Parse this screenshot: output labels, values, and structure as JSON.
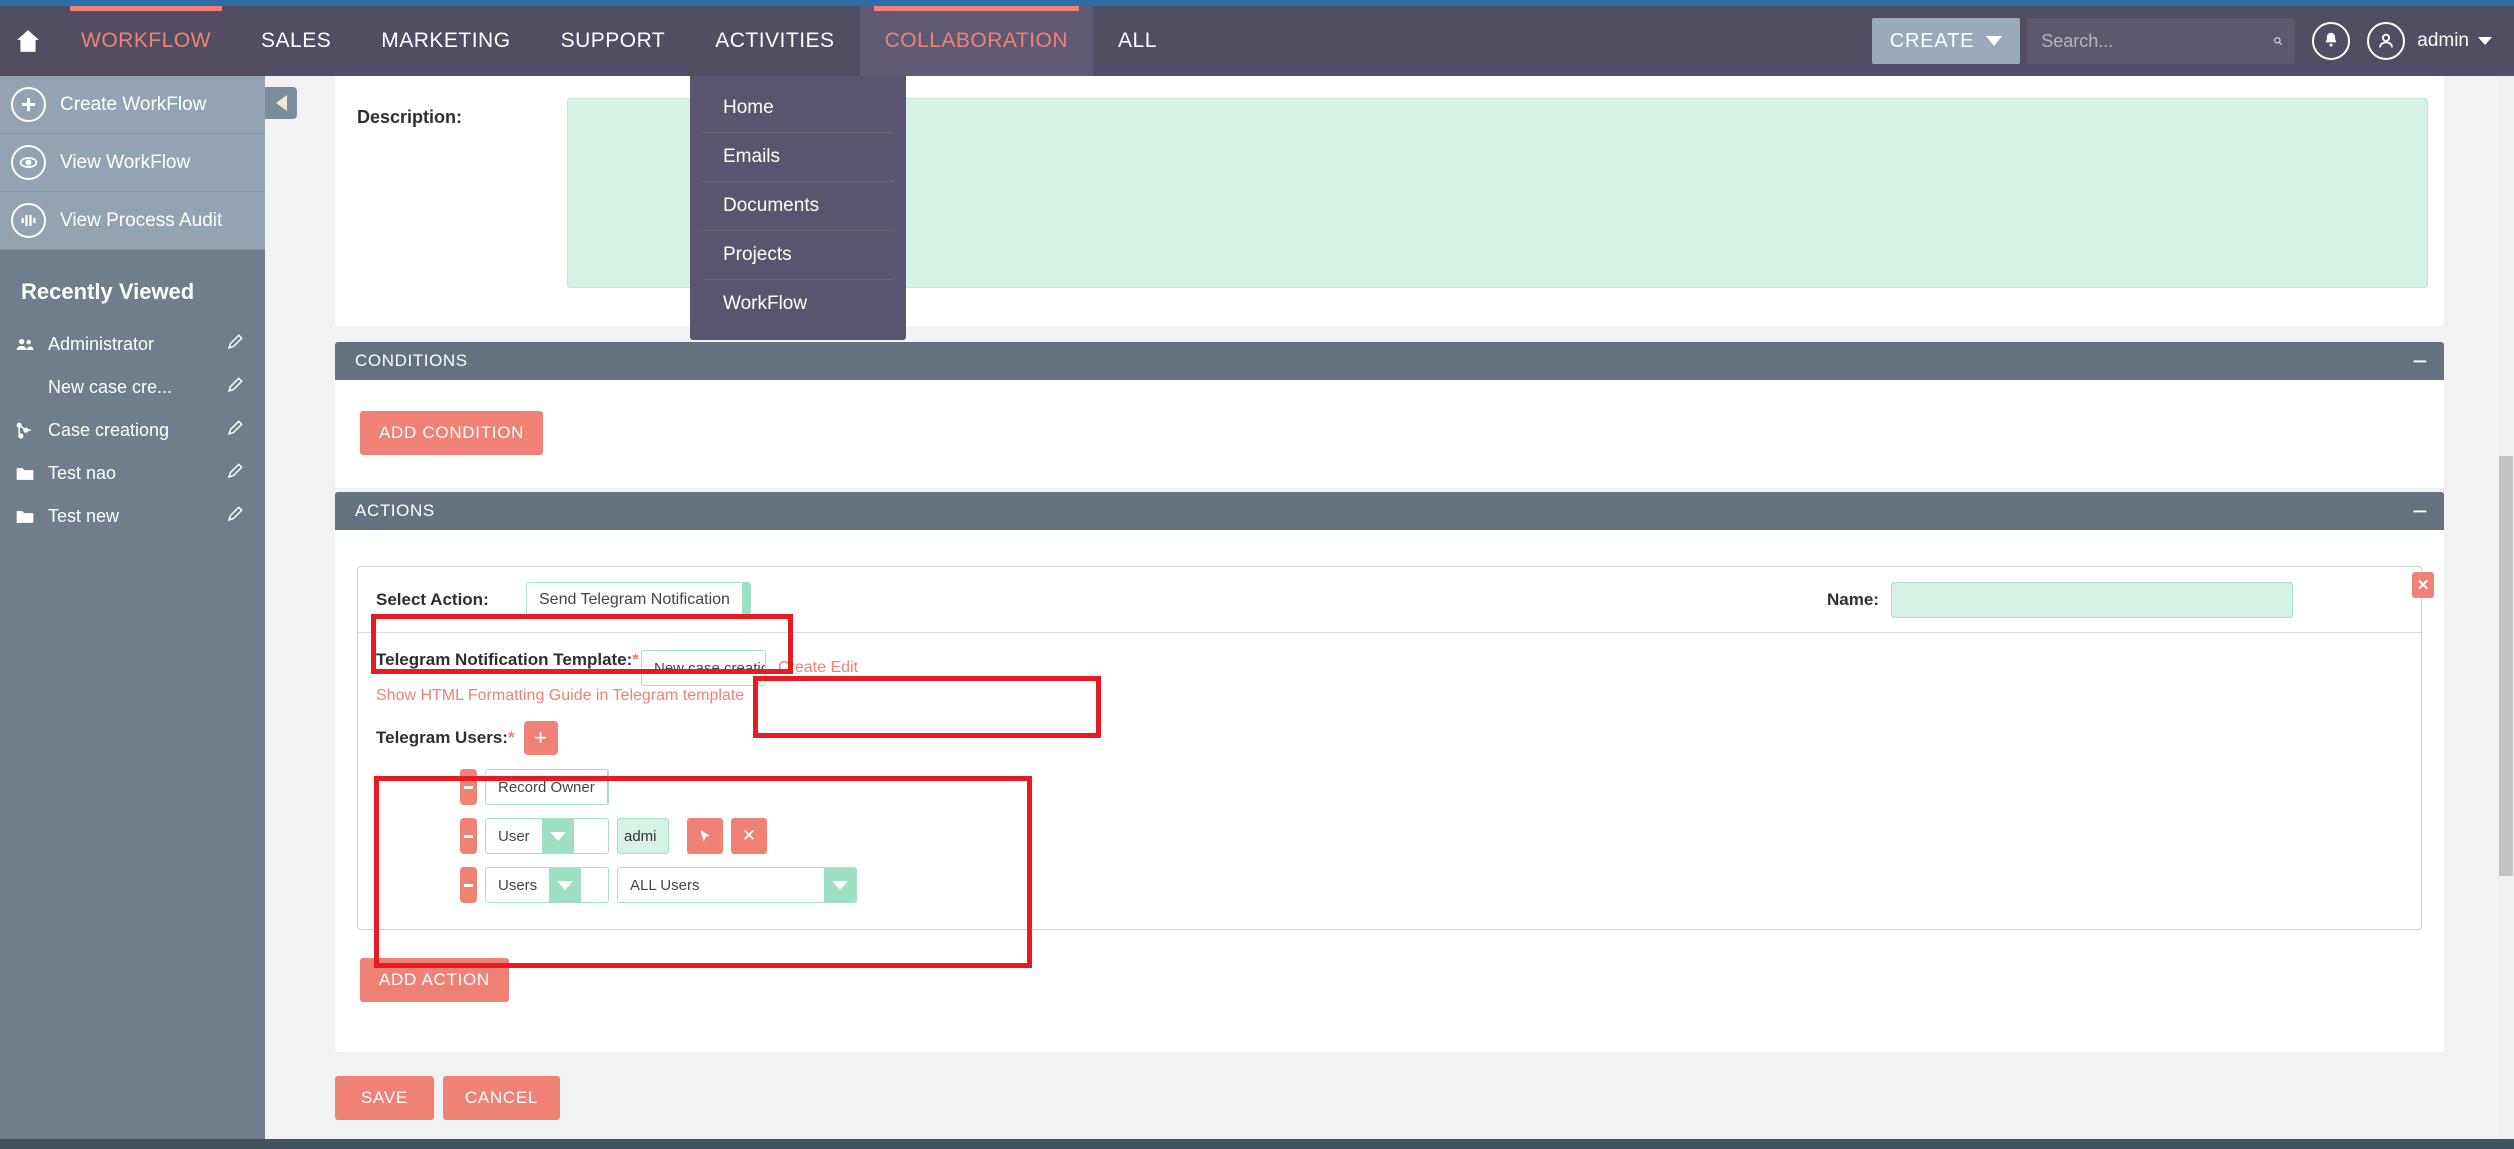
{
  "header": {
    "home_icon": "home-icon",
    "nav": [
      {
        "label": "WORKFLOW",
        "accent": true,
        "active": false
      },
      {
        "label": "SALES",
        "accent": false,
        "active": false
      },
      {
        "label": "MARKETING",
        "accent": false,
        "active": false
      },
      {
        "label": "SUPPORT",
        "accent": false,
        "active": false
      },
      {
        "label": "ACTIVITIES",
        "accent": false,
        "active": false
      },
      {
        "label": "COLLABORATION",
        "accent": true,
        "active": true
      },
      {
        "label": "ALL",
        "accent": false,
        "active": false
      }
    ],
    "create_label": "CREATE",
    "search_placeholder": "Search...",
    "search_value": "",
    "search_icon": "search-icon",
    "notification_icon": "notification-bell-icon",
    "avatar_icon": "user-avatar-icon",
    "account_label": "admin",
    "accent_color": "#ef8275",
    "header_bg": "#534d64"
  },
  "dropdown": {
    "parent": "COLLABORATION",
    "items": [
      "Home",
      "Emails",
      "Documents",
      "Projects",
      "WorkFlow"
    ]
  },
  "sidebar": {
    "actions": [
      {
        "label": "Create WorkFlow",
        "icon": "plus-circle-icon"
      },
      {
        "label": "View WorkFlow",
        "icon": "eye-icon"
      },
      {
        "label": "View Process Audit",
        "icon": "audit-waveform-icon"
      }
    ],
    "recently_viewed_title": "Recently Viewed",
    "recently_viewed": [
      {
        "label": "Administrator",
        "icon": "users-icon"
      },
      {
        "label": "New case cre...",
        "icon": "none"
      },
      {
        "label": "Case creationg",
        "icon": "workflow-node-icon"
      },
      {
        "label": "Test nao",
        "icon": "folder-icon"
      },
      {
        "label": "Test new",
        "icon": "folder-icon"
      }
    ],
    "edit_icon": "pencil-edit-icon",
    "collapse_toggle": "sidebar-collapse-arrow"
  },
  "description": {
    "label": "Description:",
    "value": "",
    "placeholder": ""
  },
  "conditions": {
    "title": "CONDITIONS",
    "collapse_symbol": "−",
    "add_button": "ADD CONDITION"
  },
  "actions_section": {
    "title": "ACTIONS",
    "collapse_symbol": "−",
    "add_button": "ADD ACTION",
    "card": {
      "select_action_label": "Select Action:",
      "select_action_value": "Send Telegram Notification",
      "name_label": "Name:",
      "name_value": "",
      "remove_icon": "close-icon",
      "template_label": "Telegram Notification Template:",
      "template_required": "*",
      "template_value": "New case creation",
      "template_create_edit": "Create Edit",
      "html_guide_link": "Show HTML Formatting Guide in Telegram template",
      "users_label": "Telegram Users:",
      "users_required": "*",
      "add_user_icon": "plus-icon",
      "rows": [
        {
          "type": "Record Owner",
          "extra": "none"
        },
        {
          "type": "User",
          "extra": "text",
          "text_value": "admi",
          "select_icon": "cursor-select-icon",
          "clear_icon": "clear-x-icon"
        },
        {
          "type": "Users",
          "extra": "select",
          "select_value": "ALL Users"
        }
      ]
    }
  },
  "footer": {
    "save_label": "SAVE",
    "cancel_label": "CANCEL"
  },
  "colors": {
    "accent": "#ef8275",
    "header": "#534d64",
    "sidebar": "#6f7d8c",
    "section_header": "#66717f",
    "highlight": "#e81b23",
    "input_mint": "#d6f2e5"
  }
}
